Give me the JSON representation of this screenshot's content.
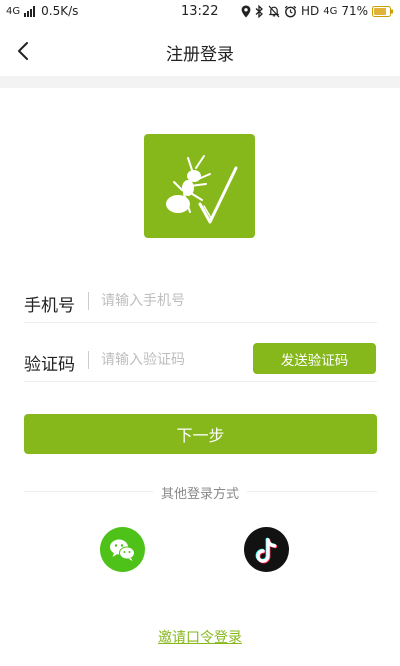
{
  "status_bar": {
    "network": "4G",
    "speed": "0.5K/s",
    "time": "13:22",
    "hd": "HD",
    "net4g": "4G",
    "battery": "71%"
  },
  "header": {
    "title": "注册登录"
  },
  "form": {
    "phone_label": "手机号",
    "phone_placeholder": "请输入手机号",
    "phone_value": "",
    "code_label": "验证码",
    "code_placeholder": "请输入验证码",
    "code_value": "",
    "send_code_label": "发送验证码",
    "next_label": "下一步"
  },
  "other_login": {
    "title": "其他登录方式",
    "methods": [
      {
        "icon": "wechat-icon"
      },
      {
        "icon": "tiktok-icon"
      }
    ]
  },
  "invite_link": "邀请口令登录",
  "colors": {
    "accent": "#86b81c",
    "wechat": "#4fc21a",
    "tiktok": "#121212"
  }
}
